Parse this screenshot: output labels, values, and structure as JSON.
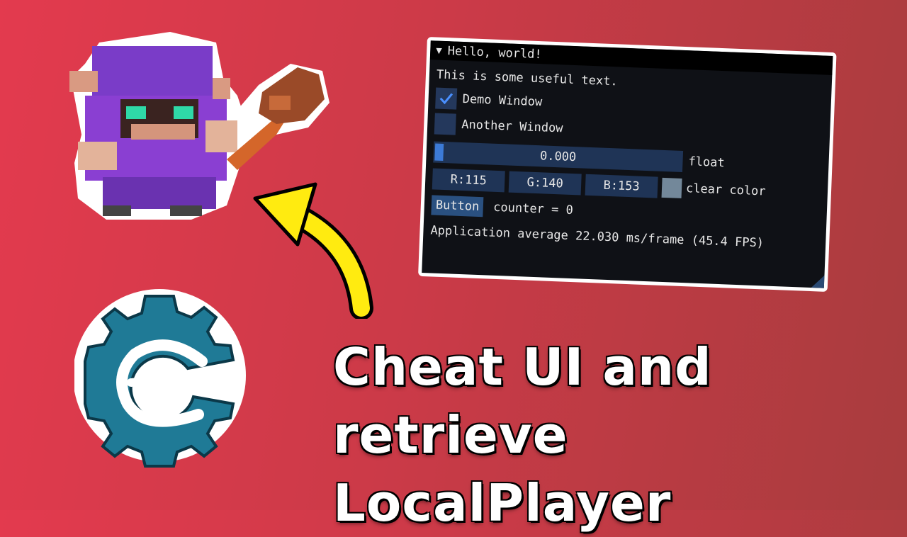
{
  "imgui": {
    "title": "Hello, world!",
    "text": "This is some useful text.",
    "checkbox_demo": {
      "label": "Demo Window",
      "checked": true
    },
    "checkbox_another": {
      "label": "Another Window",
      "checked": false
    },
    "slider": {
      "value": "0.000",
      "label": "float",
      "fraction": 0.0
    },
    "color": {
      "r": "R:115",
      "g": "G:140",
      "b": "B:153",
      "label": "clear color",
      "swatch": "#73889a"
    },
    "button_label": "Button",
    "counter_text": "counter = 0",
    "fps_text": "Application average 22.030 ms/frame (45.4 FPS)"
  },
  "caption": {
    "line1": "Cheat UI and",
    "line2": "retrieve LocalPlayer"
  },
  "icons": [
    "voxel-character-icon",
    "arrow-icon",
    "cheat-engine-logo-icon"
  ]
}
